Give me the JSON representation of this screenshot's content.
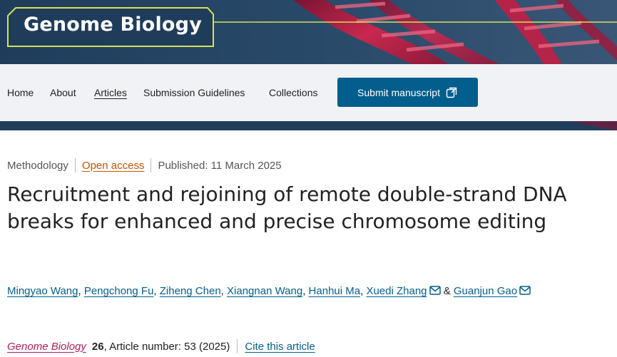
{
  "banner": {
    "journal_name": "Genome Biology",
    "accent_color": "#d4e157"
  },
  "nav": {
    "items": [
      {
        "label": "Home",
        "active": false
      },
      {
        "label": "About",
        "active": false
      },
      {
        "label": "Articles",
        "active": true
      },
      {
        "label": "Submission Guidelines",
        "active": false
      },
      {
        "label": "Collections",
        "active": false
      }
    ],
    "submit_label": "Submit manuscript",
    "submit_icon": "external-link-icon",
    "button_color": "#025e8d"
  },
  "article": {
    "type": "Methodology",
    "access": "Open access",
    "published": "Published: 11 March 2025",
    "title": "Recruitment and rejoining of remote double-strand DNA breaks for enhanced and precise chromosome editing",
    "authors": [
      {
        "name": "Mingyao Wang",
        "mail": false
      },
      {
        "name": "Pengchong Fu",
        "mail": false
      },
      {
        "name": "Ziheng Chen",
        "mail": false
      },
      {
        "name": "Xiangnan Wang",
        "mail": false
      },
      {
        "name": "Hanhui Ma",
        "mail": false
      },
      {
        "name": "Xuedi Zhang",
        "mail": true
      },
      {
        "name": "Guanjun Gao",
        "mail": true
      }
    ],
    "author_separator": ", ",
    "author_last_joiner": " & ",
    "journal": "Genome Biology",
    "volume": "26",
    "article_number": ", Article number: 53 (2025)",
    "cite_label": "Cite this article"
  }
}
